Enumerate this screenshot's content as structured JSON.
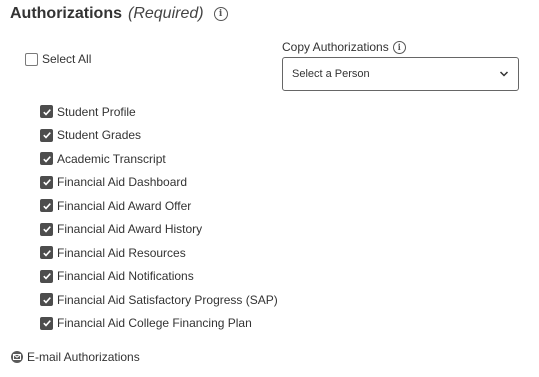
{
  "section": {
    "title": "Authorizations",
    "required": "(Required)",
    "info_icon": "info-icon"
  },
  "select_all": {
    "label": "Select All",
    "checked": false
  },
  "authorizations": [
    {
      "label": "Student Profile",
      "checked": true
    },
    {
      "label": "Student Grades",
      "checked": true
    },
    {
      "label": "Academic Transcript",
      "checked": true
    },
    {
      "label": "Financial Aid Dashboard",
      "checked": true
    },
    {
      "label": "Financial Aid Award Offer",
      "checked": true
    },
    {
      "label": "Financial Aid Award History",
      "checked": true
    },
    {
      "label": "Financial Aid Resources",
      "checked": true
    },
    {
      "label": "Financial Aid Notifications",
      "checked": true
    },
    {
      "label": "Financial Aid Satisfactory Progress (SAP)",
      "checked": true
    },
    {
      "label": "Financial Aid College Financing Plan",
      "checked": true
    }
  ],
  "copy_authorizations": {
    "label": "Copy Authorizations",
    "selected": "Select a Person"
  },
  "email_authorizations": {
    "label": "E-mail Authorizations",
    "icon": "mail-icon"
  }
}
